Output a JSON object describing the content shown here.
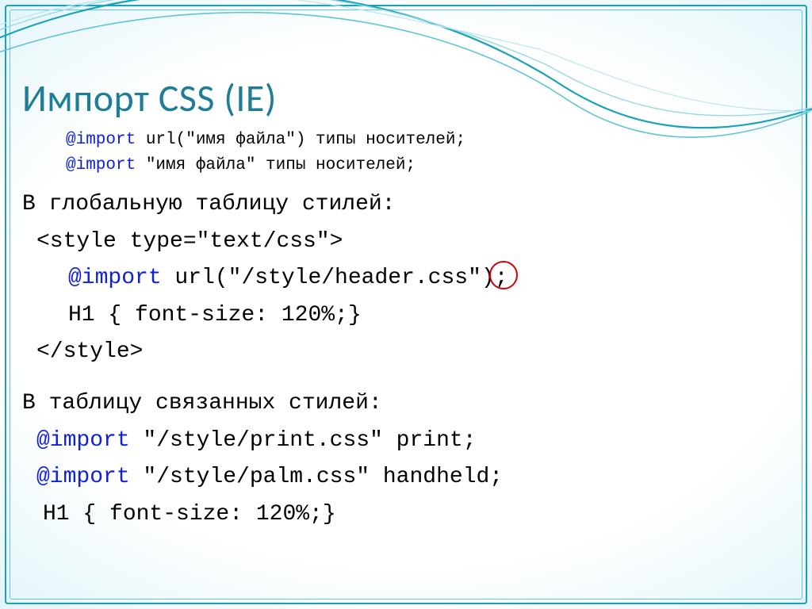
{
  "title": "Импорт CSS (IE)",
  "syntax": {
    "import_kw": "@import",
    "line1_rest": " url(\"имя файла\") типы носителей;",
    "line2_rest": " \"имя файла\" типы носителей;"
  },
  "section1": {
    "heading": "В глобальную таблицу стилей:",
    "style_open": "<style type=\"text/css\">",
    "import_kw": "@import",
    "import_rest": " url(\"/style/header.css\")",
    "import_semi": ";",
    "h1_rule": "H1 { font-size: 120%;}",
    "style_close": "</style>"
  },
  "section2": {
    "heading": "В таблицу связанных стилей:",
    "import_kw": "@import",
    "importA_rest": " \"/style/print.css\" print;",
    "importB_rest": " \"/style/palm.css\" handheld;",
    "h1_rule": "H1 { font-size: 120%;}"
  }
}
